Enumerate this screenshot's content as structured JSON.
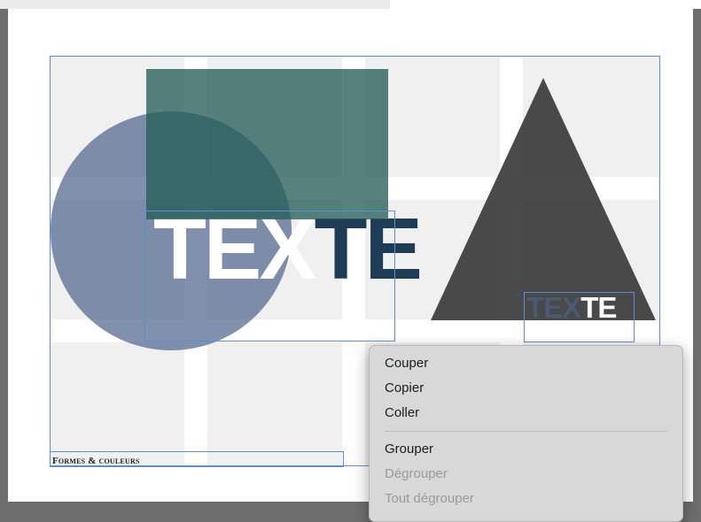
{
  "canvas": {
    "big_text": {
      "part_light": "TEX",
      "part_dark": "TE"
    },
    "small_text": {
      "part_dark": "TEX",
      "part_light": "TE"
    },
    "footer_label": "Formes & couleurs",
    "colors": {
      "circle": "#556991",
      "rectangle": "#265e58",
      "triangle": "#3c3c3c",
      "guide": "#5a8fd6"
    }
  },
  "context_menu": {
    "group1": [
      {
        "label": "Couper",
        "enabled": true
      },
      {
        "label": "Copier",
        "enabled": true
      },
      {
        "label": "Coller",
        "enabled": true
      }
    ],
    "group2": [
      {
        "label": "Grouper",
        "enabled": true
      },
      {
        "label": "Dégrouper",
        "enabled": false
      },
      {
        "label": "Tout dégrouper",
        "enabled": false
      }
    ]
  }
}
